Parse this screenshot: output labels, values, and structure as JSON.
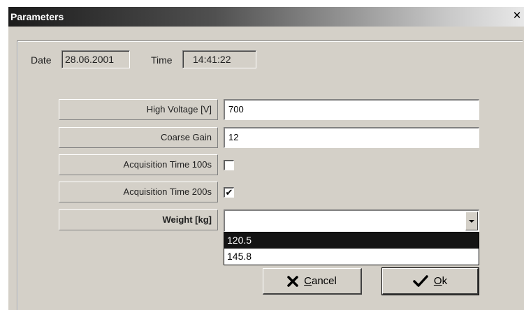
{
  "window": {
    "title": "Parameters",
    "close_glyph": "✕"
  },
  "header": {
    "date_label": "Date",
    "date_value": "28.06.2001",
    "time_label": "Time",
    "time_value": "14:41:22"
  },
  "params": {
    "high_voltage": {
      "label": "High Voltage [V]",
      "value": "700"
    },
    "coarse_gain": {
      "label": "Coarse Gain",
      "value": "12"
    },
    "acq_100": {
      "label": "Acquisition Time 100s",
      "checked": false
    },
    "acq_200": {
      "label": "Acquisition Time 200s",
      "checked": true,
      "check_glyph": "✔"
    },
    "weight": {
      "label": "Weight [kg]",
      "value": "",
      "options": [
        "120.5",
        "145.8"
      ],
      "highlighted": "120.5"
    }
  },
  "buttons": {
    "cancel_accel": "C",
    "cancel_rest": "ancel",
    "cancel_icon": "x-icon",
    "ok_accel": "O",
    "ok_rest": "k",
    "ok_icon": "checkmark-icon"
  }
}
